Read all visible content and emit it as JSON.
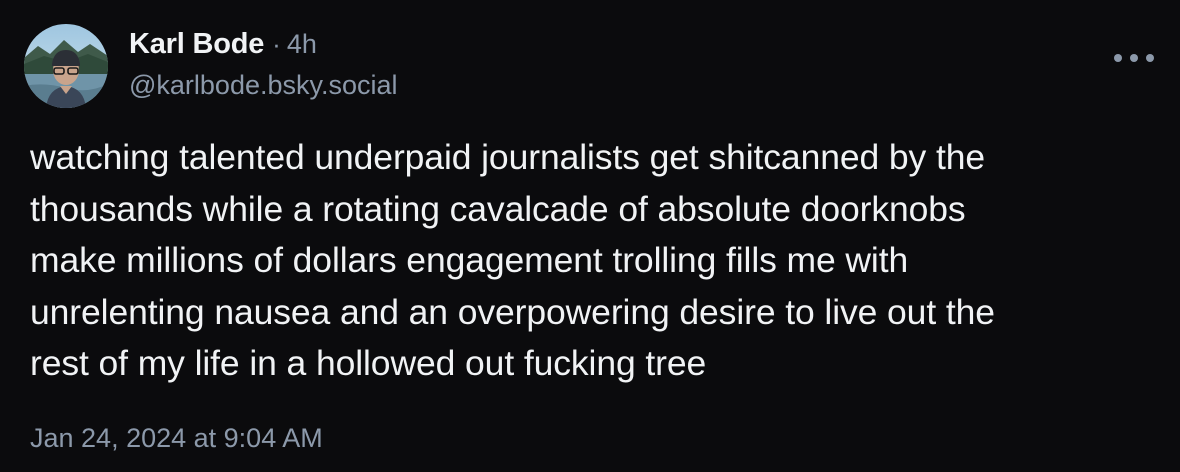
{
  "author": {
    "display_name": "Karl Bode",
    "separator": "·",
    "time_ago": "4h",
    "handle": "@karlbode.bsky.social",
    "avatar_icon": "avatar-photo"
  },
  "post": {
    "text": "watching talented underpaid journalists get shitcanned by the\nthousands while a rotating cavalcade of absolute doorknobs\nmake millions of dollars engagement trolling fills me with\nunrelenting nausea and an overpowering desire to live out the\nrest of my life in a hollowed out fucking tree",
    "timestamp": "Jan 24, 2024 at 9:04 AM"
  },
  "menu": {
    "icon": "more-horizontal-icon"
  },
  "colors": {
    "background": "#0b0b0d",
    "primary_text": "#f1f3f5",
    "secondary_text": "#8c99aa"
  }
}
